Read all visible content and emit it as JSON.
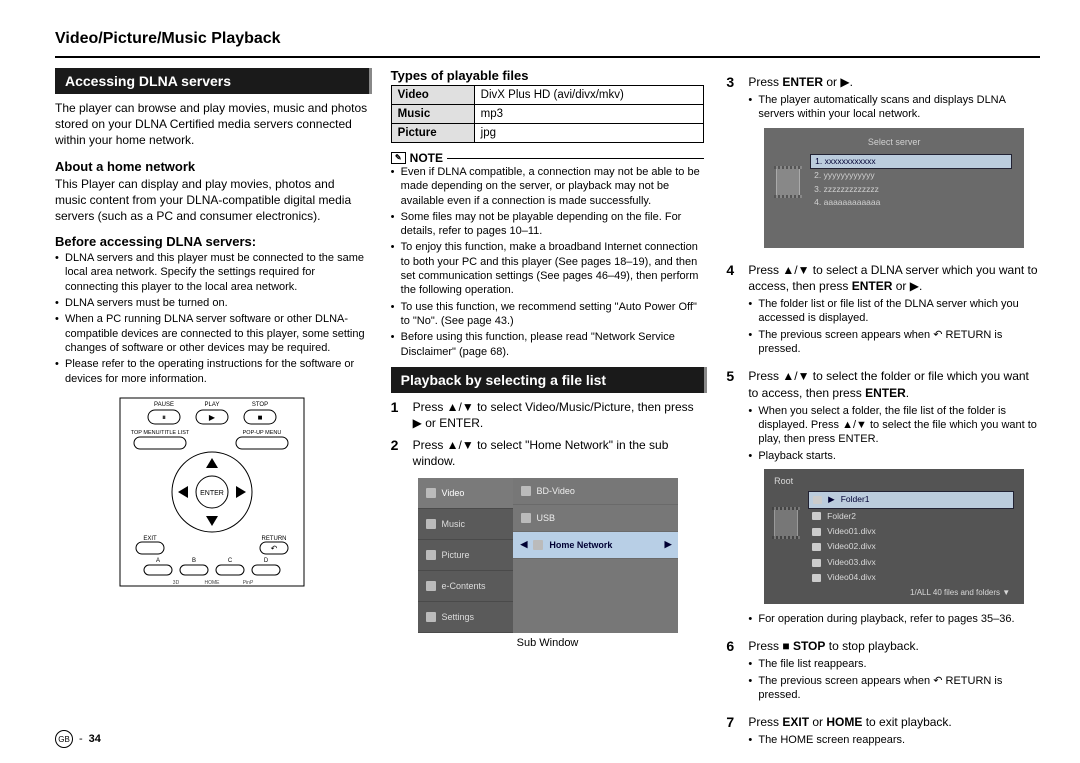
{
  "page_title": "Video/Picture/Music Playback",
  "page_num_lang": "GB",
  "page_num": "34",
  "col1": {
    "heading": "Accessing DLNA servers",
    "intro": "The player can browse and play movies, music and photos stored on your DLNA Certified media servers connected within your home network.",
    "about_h": "About a home network",
    "about_p": "This Player can display and play movies, photos and music content from your DLNA-compatible digital media servers (such as a PC and consumer electronics).",
    "before_h": "Before accessing DLNA servers:",
    "before": [
      "DLNA servers and this player must be connected to the same local area network. Specify the settings required for connecting this player to the local area network.",
      "DLNA servers must be turned on.",
      "When a PC running DLNA server software or other DLNA-compatible devices are connected to this player, some setting changes of software or other devices may be required.",
      "Please refer to the operating instructions for the software or devices for more information."
    ]
  },
  "col2": {
    "types_h": "Types of playable files",
    "types": [
      {
        "k": "Video",
        "v": "DivX Plus HD (avi/divx/mkv)"
      },
      {
        "k": "Music",
        "v": "mp3"
      },
      {
        "k": "Picture",
        "v": "jpg"
      }
    ],
    "note_label": "NOTE",
    "notes": [
      "Even if DLNA compatible, a connection may not be able to be made depending on the server, or playback may not be available even if a connection is made successfully.",
      "Some files may not be playable depending on the file. For details, refer to pages 10–11.",
      "To enjoy this function, make a broadband Internet connection to both your PC and this player (See pages 18–19), and then set communication settings (See pages 46–49), then perform the following operation.",
      "To use this function, we recommend setting \"Auto Power Off\" to \"No\". (See page 43.)",
      "Before using this function, please read \"Network Service Disclaimer\" (page 68)."
    ],
    "heading2": "Playback by selecting a file list",
    "s1": "Press ▲/▼ to select Video/Music/Picture, then press ▶ or ENTER.",
    "s2": "Press ▲/▼ to select \"Home Network\" in the sub window.",
    "subwin_caption": "Sub Window",
    "subwin": {
      "left": [
        "Video",
        "Music",
        "Picture",
        "e-Contents",
        "Settings"
      ],
      "right": [
        "BD-Video",
        "USB",
        "Home Network"
      ]
    }
  },
  "col3": {
    "s3_pre": "Press ",
    "s3_b": "ENTER",
    "s3_post": " or ▶.",
    "s3_bul": [
      "The player automatically scans and displays DLNA servers within your local network."
    ],
    "srv": {
      "title": "Select server",
      "items": [
        "1. xxxxxxxxxxxx",
        "2. yyyyyyyyyyyy",
        "3. zzzzzzzzzzzzz",
        "4. aaaaaaaaaaaa"
      ]
    },
    "s4_a": "Press ▲/▼ to select a DLNA server which you want to access, then press ",
    "s4_b": "ENTER",
    "s4_c": " or ▶.",
    "s4_bul": [
      "The folder list or file list of the DLNA server which you accessed is displayed.",
      "The previous screen appears when  ↶ RETURN is pressed."
    ],
    "s5_a": "Press ▲/▼ to select the folder or file which you want to access, then press ",
    "s5_b": "ENTER",
    "s5_c": ".",
    "s5_bul": [
      "When you select a folder, the file list of the folder is displayed. Press ▲/▼ to select the file which you want to play, then press ENTER.",
      "Playback starts."
    ],
    "root": {
      "title": "Root",
      "items": [
        "Folder1",
        "Folder2",
        "Video01.divx",
        "Video02.divx",
        "Video03.divx",
        "Video04.divx"
      ],
      "foot": "1/ALL  40 files and folders ▼"
    },
    "root_bul": [
      "For operation during playback, refer to pages 35–36."
    ],
    "s6_a": "Press ■ ",
    "s6_b": "STOP",
    "s6_c": " to stop playback.",
    "s6_bul": [
      "The file list reappears.",
      "The previous screen appears when  ↶ RETURN is pressed."
    ],
    "s7_a": "Press ",
    "s7_b1": "EXIT",
    "s7_or": " or ",
    "s7_b2": "HOME",
    "s7_c": " to exit playback.",
    "s7_bul": [
      "The HOME screen reappears."
    ]
  }
}
